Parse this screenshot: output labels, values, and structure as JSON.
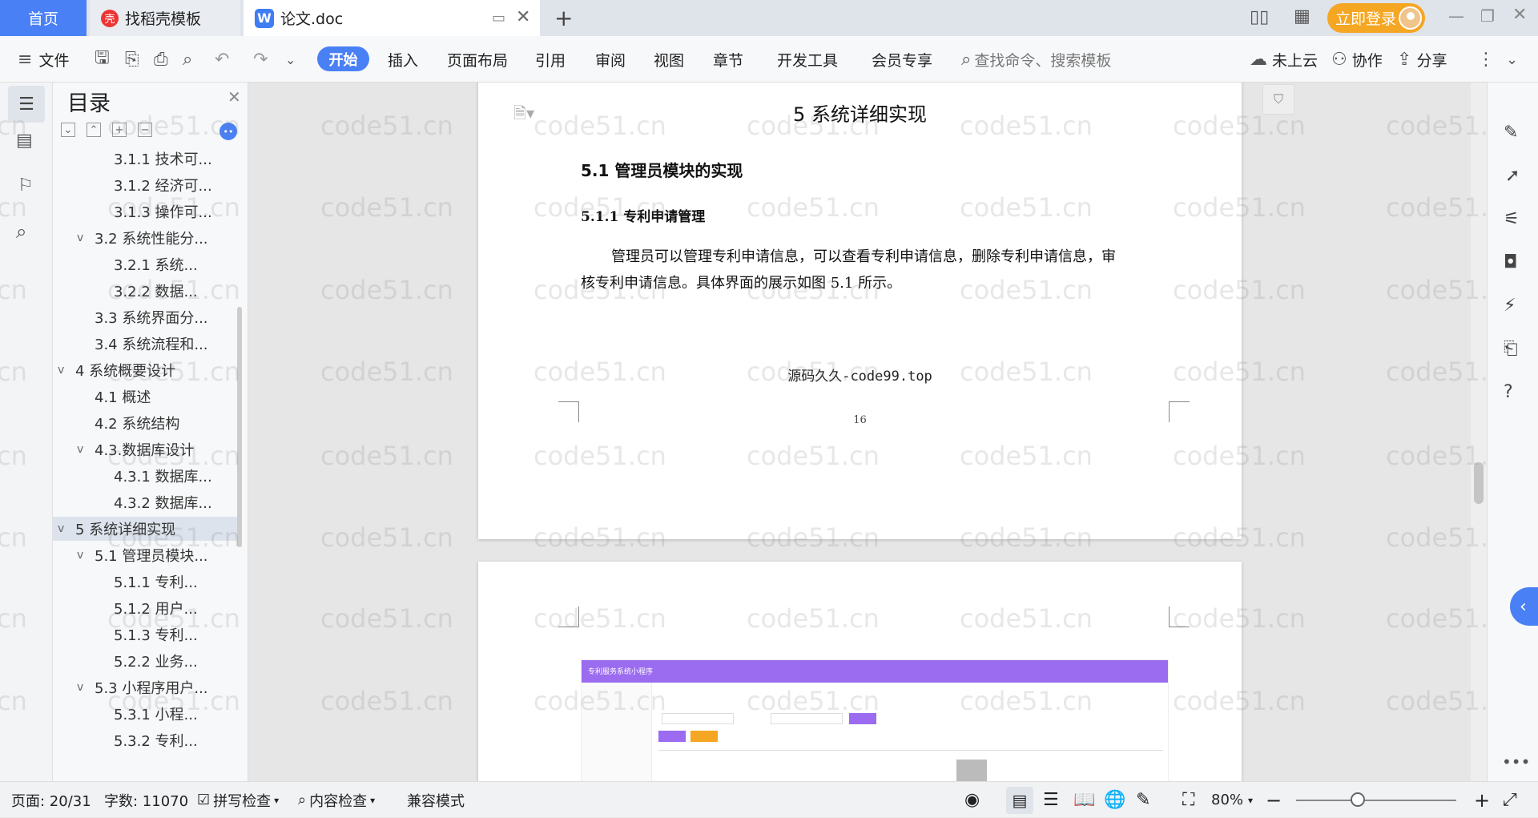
{
  "tabs": {
    "home": "首页",
    "templates": "找稻壳模板",
    "document": "论文.doc",
    "login": "立即登录"
  },
  "toolbar": {
    "file": "文件",
    "ribbon": [
      "开始",
      "插入",
      "页面布局",
      "引用",
      "审阅",
      "视图",
      "章节",
      "开发工具",
      "会员专享"
    ],
    "search_placeholder": "查找命令、搜索模板",
    "cloud": "未上云",
    "collab": "协作",
    "share": "分享"
  },
  "toc": {
    "title": "目录",
    "items": [
      {
        "level": 3,
        "label": "3.1.1 技术可...",
        "expander": ""
      },
      {
        "level": 3,
        "label": "3.1.2 经济可...",
        "expander": ""
      },
      {
        "level": 3,
        "label": "3.1.3 操作可...",
        "expander": ""
      },
      {
        "level": 2,
        "label": "3.2 系统性能分...",
        "expander": "v"
      },
      {
        "level": 3,
        "label": "3.2.1  系统...",
        "expander": ""
      },
      {
        "level": 3,
        "label": "3.2.2  数据...",
        "expander": ""
      },
      {
        "level": 2,
        "label": "3.3 系统界面分...",
        "expander": ""
      },
      {
        "level": 2,
        "label": "3.4 系统流程和...",
        "expander": ""
      },
      {
        "level": 1,
        "label": "4 系统概要设计",
        "expander": "v"
      },
      {
        "level": 2,
        "label": "4.1 概述",
        "expander": ""
      },
      {
        "level": 2,
        "label": "4.2 系统结构",
        "expander": ""
      },
      {
        "level": 2,
        "label": "4.3.数据库设计",
        "expander": "v"
      },
      {
        "level": 3,
        "label": "4.3.1 数据库...",
        "expander": ""
      },
      {
        "level": 3,
        "label": "4.3.2 数据库...",
        "expander": ""
      },
      {
        "level": 1,
        "label": "5 系统详细实现",
        "expander": "v",
        "active": true
      },
      {
        "level": 2,
        "label": "5.1  管理员模块...",
        "expander": "v"
      },
      {
        "level": 3,
        "label": "5.1.1  专利...",
        "expander": ""
      },
      {
        "level": 3,
        "label": "5.1.2  用户...",
        "expander": ""
      },
      {
        "level": 3,
        "label": "5.1.3  专利...",
        "expander": ""
      },
      {
        "level": 3,
        "label": "5.2.2  业务...",
        "expander": ""
      },
      {
        "level": 2,
        "label": "5.3  小程序用户...",
        "expander": "v"
      },
      {
        "level": 3,
        "label": "5.3.1  小程...",
        "expander": ""
      },
      {
        "level": 3,
        "label": "5.3.2  专利...",
        "expander": ""
      }
    ]
  },
  "document": {
    "chapter_title": "5 系统详细实现",
    "section_title": "5.1  管理员模块的实现",
    "subsection_title": "5.1.1  专利申请管理",
    "para_line1": "管理员可以管理专利申请信息，可以查看专利申请信息，删除专利申请信息，审",
    "para_line2": "核专利申请信息。具体界面的展示如图 5.1 所示。",
    "source_note": "源码久久-code99.top",
    "page_number": "16",
    "screenshot_app_title": "专利服务系统小程序"
  },
  "watermark": "code51.cn",
  "status": {
    "page": "页面: 20/31",
    "words": "字数: 11070",
    "spell": "拼写检查",
    "content_check": "内容检查",
    "compat": "兼容模式",
    "zoom": "80%"
  },
  "colors": {
    "accent": "#4a80f5",
    "login": "#f5a623",
    "purple": "#9b6cf0"
  }
}
